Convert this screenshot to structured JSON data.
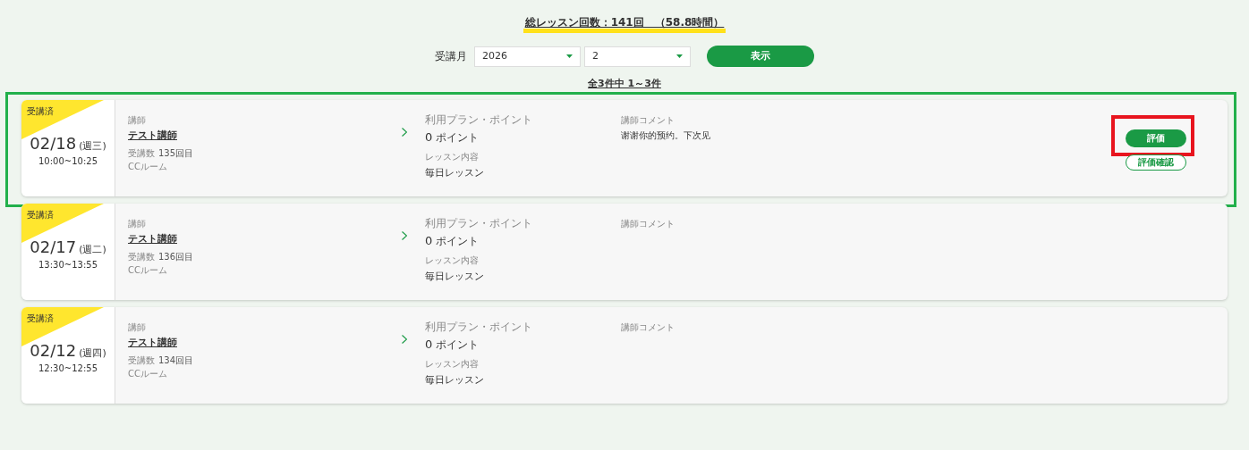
{
  "summary": {
    "title": "総レッスン回数：141回　（58.8時間）"
  },
  "filter": {
    "label": "受講月",
    "year": "2026",
    "month": "2",
    "button": "表示"
  },
  "count": "全3件中 1～3件",
  "lessons": [
    {
      "highlighted": true,
      "status": "受講済",
      "date": "02/18",
      "weekday": "(週三)",
      "time": "10:00~10:25",
      "teacher_label": "講師",
      "teacher": "テスト講師",
      "count_label": "受講数",
      "count": "135回目",
      "room": "CCルーム",
      "plan_label": "利用プラン・ポイント",
      "points": "0",
      "points_unit": "ポイント",
      "content_label": "レッスン内容",
      "content": "毎日レッスン",
      "comment_label": "講師コメント",
      "comment": "谢谢你的预约。下次见",
      "buttons": [
        {
          "label": "評価",
          "kind": "filled",
          "highlighted": true
        },
        {
          "label": "評価確認",
          "kind": "outline"
        }
      ]
    },
    {
      "highlighted": false,
      "status": "受講済",
      "date": "02/17",
      "weekday": "(週二)",
      "time": "13:30~13:55",
      "teacher_label": "講師",
      "teacher": "テスト講師",
      "count_label": "受講数",
      "count": "136回目",
      "room": "CCルーム",
      "plan_label": "利用プラン・ポイント",
      "points": "0",
      "points_unit": "ポイント",
      "content_label": "レッスン内容",
      "content": "毎日レッスン",
      "comment_label": "講師コメント"
    },
    {
      "highlighted": false,
      "status": "受講済",
      "date": "02/12",
      "weekday": "(週四)",
      "time": "12:30~12:55",
      "teacher_label": "講師",
      "teacher": "テスト講師",
      "count_label": "受講数",
      "count": "134回目",
      "room": "CCルーム",
      "plan_label": "利用プラン・ポイント",
      "points": "0",
      "points_unit": "ポイント",
      "content_label": "レッスン内容",
      "content": "毎日レッスン",
      "comment_label": "講師コメント"
    }
  ]
}
